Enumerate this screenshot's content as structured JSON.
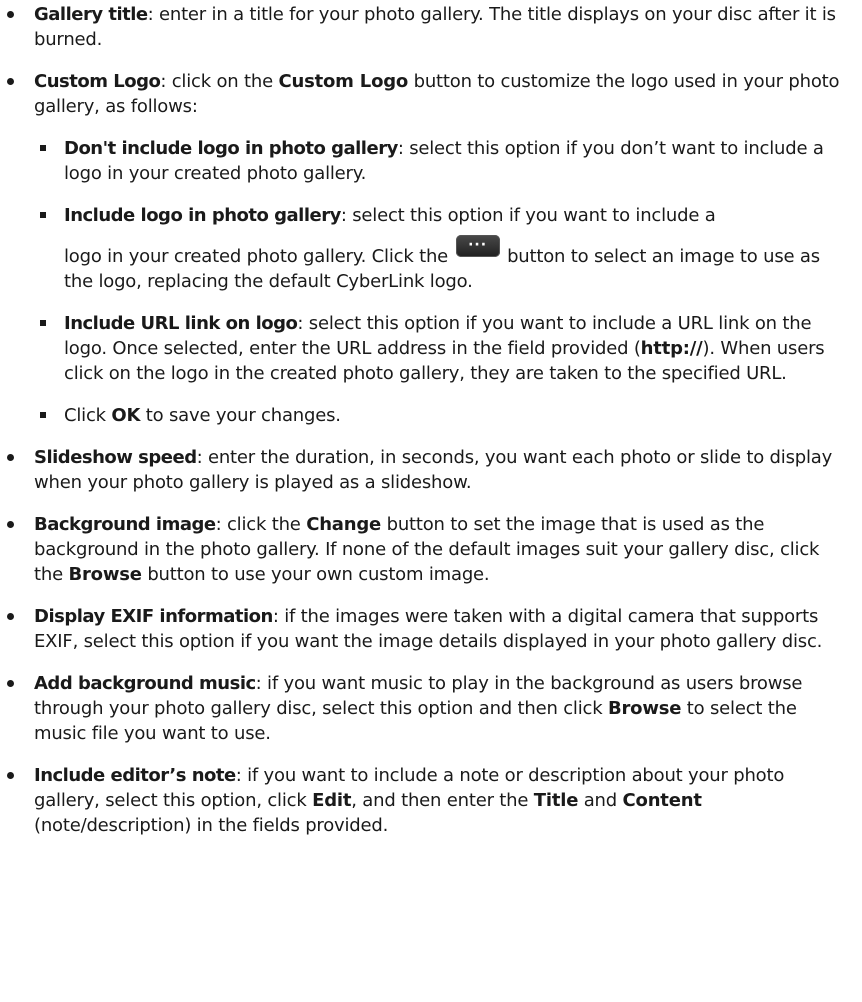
{
  "items": [
    {
      "term": "Gallery title",
      "text": ": enter in a title for your photo gallery. The title displays on your disc after it is burned."
    },
    {
      "term": "Custom Logo",
      "pre": ": click on the ",
      "bold": "Custom Logo",
      "post": " button to customize the logo used in your photo gallery, as follows:",
      "sub": [
        {
          "term": "Don't include logo in photo gallery",
          "text": ": select this option if you don’t want to include a logo in your created photo gallery."
        },
        {
          "term": "Include logo in photo gallery",
          "text_a": ": select this option if you want to include a",
          "text_b": "logo in your created photo gallery. Click the ",
          "button_label": "···",
          "text_c": " button to select an image to use as the logo, replacing the default CyberLink logo."
        },
        {
          "term": "Include URL link on logo",
          "text_a": ": select this option if you want to include a URL link on the logo. Once selected, enter the URL address in the field provided (",
          "bold": "http://",
          "text_b": "). When users click on the logo in the created photo gallery, they are taken to the specified URL."
        },
        {
          "pre": "Click ",
          "bold": "OK",
          "post": " to save your changes."
        }
      ]
    },
    {
      "term": "Slideshow speed",
      "text": ": enter the duration, in seconds, you want each photo or slide to display when your photo gallery is played as a slideshow."
    },
    {
      "term": "Background image",
      "pre": ": click the ",
      "bold1": "Change",
      "mid": " button to set the image that is used as the background in the photo gallery. If none of the default images suit your gallery disc, click the ",
      "bold2": "Browse",
      "post": " button to use your own custom image."
    },
    {
      "term": "Display EXIF information",
      "text": ": if the images were taken with a digital camera that supports EXIF, select this option if you want the image details displayed in your photo gallery disc."
    },
    {
      "term": "Add background music",
      "pre": ": if you want music to play in the background as users browse through your photo gallery disc, select this option and then click ",
      "bold": "Browse",
      "post": " to select the music file you want to use."
    },
    {
      "term": "Include editor’s note",
      "pre": ": if you want to include a note or description about your photo gallery, select this option, click ",
      "bold1": "Edit",
      "mid1": ", and then enter the ",
      "bold2": "Title",
      "mid2": " and ",
      "bold3": "Content",
      "post": " (note/description) in the fields provided."
    }
  ]
}
